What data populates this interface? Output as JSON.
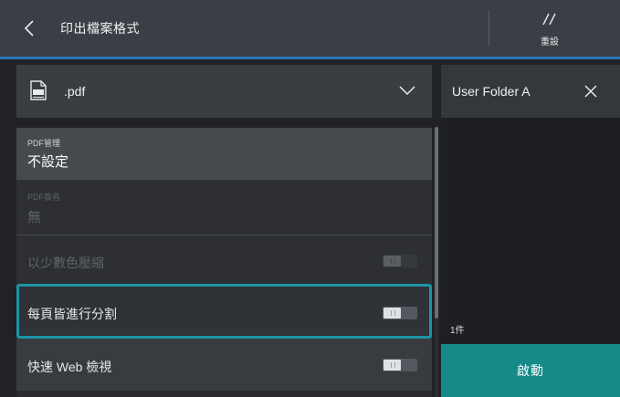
{
  "header": {
    "back_icon": "chevron-left-icon",
    "title": "印出檔案格式",
    "reset_icon": "reset-slashes-icon",
    "reset_label": "重設",
    "accent_color": "#2d74b5"
  },
  "format": {
    "icon": "pdf-file-icon",
    "selected": ".pdf",
    "dropdown_icon": "chevron-down-icon"
  },
  "settings": {
    "pdf_security": {
      "caption": "PDF管理",
      "value": "不設定",
      "enabled": true
    },
    "pdf_signature": {
      "caption": "PDF簽名",
      "value": "無",
      "enabled": false
    },
    "reduce_colors": {
      "label": "以少數色壓縮",
      "toggle_on": false,
      "enabled": false
    },
    "split_pages": {
      "label": "每頁皆進行分割",
      "toggle_on": false,
      "enabled": true,
      "focused": true
    },
    "fast_web_view": {
      "label": "快速 Web 檢視",
      "toggle_on": false,
      "enabled": true
    }
  },
  "folder_panel": {
    "folder_name": "User Folder A",
    "close_icon": "close-icon",
    "count": "1件",
    "start_label": "啟動",
    "start_color": "#158a89"
  },
  "focus_color": "#1c95a2"
}
